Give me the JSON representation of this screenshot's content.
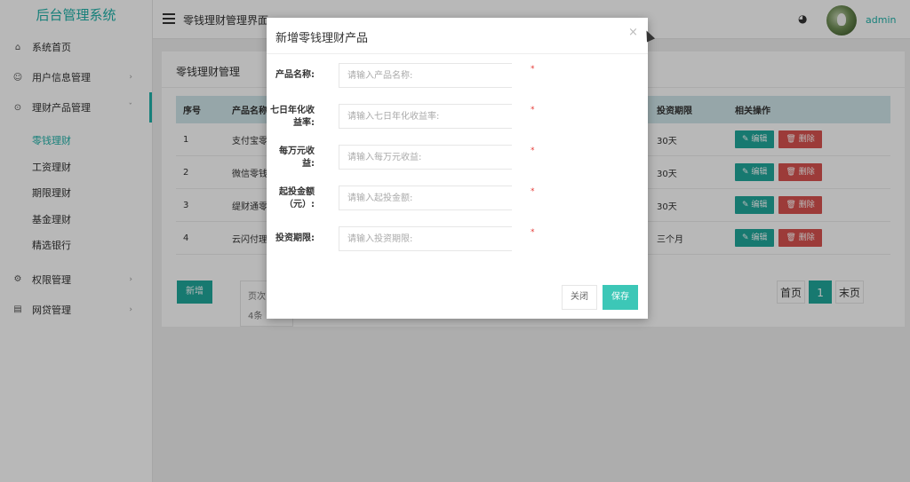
{
  "app": {
    "title": "后台管理系统"
  },
  "sidebar": {
    "items": [
      {
        "label": "系统首页",
        "icon": "home-icon"
      },
      {
        "label": "用户信息管理",
        "icon": "users-icon"
      },
      {
        "label": "理财产品管理",
        "icon": "finance-icon"
      },
      {
        "label": "权限管理",
        "icon": "permission-icon"
      },
      {
        "label": "网贷管理",
        "icon": "loan-icon"
      }
    ],
    "submenu": [
      {
        "label": "零钱理财"
      },
      {
        "label": "工资理财"
      },
      {
        "label": "期限理财"
      },
      {
        "label": "基金理财"
      },
      {
        "label": "精选银行"
      }
    ]
  },
  "header": {
    "breadcrumb": "零钱理财管理界面",
    "username": "admin",
    "theme_icon": "palette-icon",
    "accent": "#20b2aa"
  },
  "panel": {
    "title": "零钱理财管理",
    "columns": [
      "序号",
      "产品名称",
      "投资期限",
      "相关操作"
    ],
    "rows": [
      {
        "id": "1",
        "name": "支付宝零",
        "term": "30天"
      },
      {
        "id": "2",
        "name": "微信零钱",
        "term": "30天"
      },
      {
        "id": "3",
        "name": "缇财通零",
        "term": "30天"
      },
      {
        "id": "4",
        "name": "云闪付理",
        "term": "三个月"
      }
    ],
    "edit_label": "编辑",
    "delete_label": "删除",
    "add_label": "新增",
    "page_info_1": "页次",
    "page_info_2": "4条",
    "pager": {
      "first": "首页",
      "current": "1",
      "last": "末页"
    }
  },
  "modal": {
    "title": "新增零钱理财产品",
    "close_icon": "×",
    "fields": [
      {
        "label_1": "产品名称:",
        "label_2": "",
        "placeholder": "请输入产品名称:"
      },
      {
        "label_1": "七日年化收",
        "label_2": "益率:",
        "placeholder": "请输入七日年化收益率:"
      },
      {
        "label_1": "每万元收",
        "label_2": "益:",
        "placeholder": "请输入每万元收益:"
      },
      {
        "label_1": "起投金额",
        "label_2": "（元）:",
        "placeholder": "请输入起投金额:"
      },
      {
        "label_1": "投资期限:",
        "label_2": "",
        "placeholder": "请输入投资期限:"
      }
    ],
    "required_mark": "*",
    "cancel_label": "关闭",
    "save_label": "保存"
  }
}
